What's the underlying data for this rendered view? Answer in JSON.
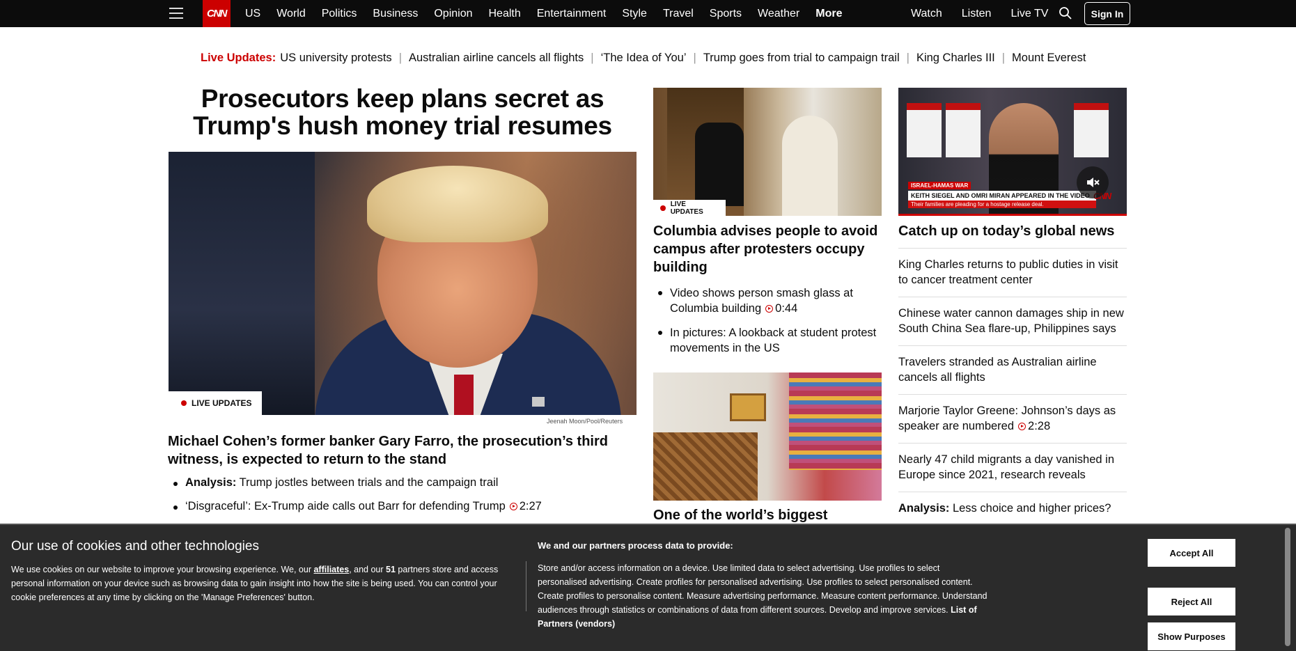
{
  "nav": {
    "logo": "CNN",
    "links": [
      "US",
      "World",
      "Politics",
      "Business",
      "Opinion",
      "Health",
      "Entertainment",
      "Style",
      "Travel",
      "Sports",
      "Weather",
      "More"
    ],
    "right_links": [
      "Watch",
      "Listen",
      "Live TV"
    ],
    "sign_in": "Sign In"
  },
  "live_strip": {
    "label": "Live Updates:",
    "items": [
      "US university protests",
      "Australian airline cancels all flights",
      "‘The Idea of You’",
      "Trump goes from trial to campaign trail",
      "King Charles III",
      "Mount Everest"
    ]
  },
  "lead": {
    "headline": "Prosecutors keep plans secret as Trump's hush money trial resumes",
    "badge": "LIVE UPDATES",
    "credit": "Jeenah Moon/Pool/Reuters",
    "subhead": "Michael Cohen’s former banker Gary Farro, the prosecution’s third witness, is expected to return to the stand",
    "bullet1_bold": "Analysis:",
    "bullet1_text": " Trump jostles between trials and the campaign trail",
    "bullet2_text": "‘Disgraceful’: Ex-Trump aide calls out Barr for defending Trump",
    "bullet2_duration": "2:27"
  },
  "middle": {
    "badge": "LIVE UPDATES",
    "headline": "Columbia advises people to avoid campus after protesters occupy building",
    "bullet1_text": "Video shows person smash glass at Columbia building",
    "bullet1_duration": "0:44",
    "bullet2_text": "In pictures: A lookback at student protest movements in the US",
    "headline2": "One of the world’s biggest"
  },
  "right": {
    "video_tag": "ISRAEL-HAMAS WAR",
    "video_bar1": "KEITH SIEGEL AND OMRI MIRAN APPEARED IN THE VIDEO",
    "video_bar2": "Their families are pleading for a hostage release deal.",
    "video_logo": "CNN",
    "headline": "Catch up on today’s global news",
    "items": [
      "King Charles returns to public duties in visit to cancer treatment center",
      "Chinese water cannon damages ship in new South China Sea flare-up, Philippines says",
      "Travelers stranded as Australian airline cancels all flights",
      "Marjorie Taylor Greene: Johnson’s days as speaker are numbered",
      "Nearly 47 child migrants a day vanished in Europe since 2021, research reveals"
    ],
    "item4_duration": "2:28",
    "last_bold": "Analysis:",
    "last_text": " Less choice and higher prices?"
  },
  "cookie": {
    "title": "Our use of cookies and other technologies",
    "desc_a": "We use cookies on our website to improve your browsing experience. We, our ",
    "desc_link": "affiliates",
    "desc_b": ", and our ",
    "desc_count": "51",
    "desc_c": " partners store and access personal information on your device such as browsing data to gain insight into how the site is being used. You can control your cookie preferences at any time by clicking on the 'Manage Preferences' button.",
    "purposes_title": "We and our partners process data to provide:",
    "purposes_text": "Store and/or access information on a device. Use limited data to select advertising. Use profiles to select personalised advertising. Create profiles for personalised advertising. Use profiles to select personalised content. Create profiles to personalise content. Measure advertising performance. Measure content performance. Understand audiences through statistics or combinations of data from different sources. Develop and improve services. ",
    "partners_link": "List of Partners (vendors)",
    "accept": "Accept All",
    "reject": "Reject All",
    "purposes_button": "Show Purposes"
  },
  "colors": {
    "brand_red": "#cc0000",
    "nav_bg": "#0c0c0c",
    "cookie_bg": "#2b2b2b"
  },
  "icons": [
    "hamburger-icon",
    "search-icon",
    "play-icon",
    "mute-icon"
  ]
}
